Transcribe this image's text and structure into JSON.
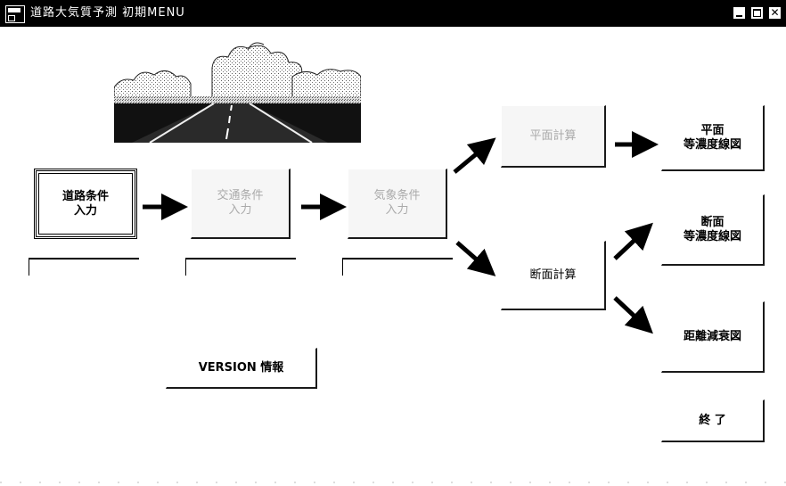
{
  "window": {
    "title": "道路大気質予測 初期MENU"
  },
  "road_image": {
    "icon": "road-landscape-icon"
  },
  "buttons": {
    "road_input": "道路条件\n入力",
    "traffic_input": "交通条件\n入力",
    "weather_input": "気象条件\n入力",
    "plane_calc": "平面計算",
    "section_calc": "断面計算",
    "plane_contour": "平面\n等濃度線図",
    "section_contour": "断面\n等濃度線図",
    "distance_decay": "距離減衰図",
    "version": "VERSION 情報",
    "exit": "終 了"
  },
  "colors": {
    "titlebar_bg": "#000000",
    "arrow": "#000000",
    "disabled_text": "#aaaaaa"
  }
}
